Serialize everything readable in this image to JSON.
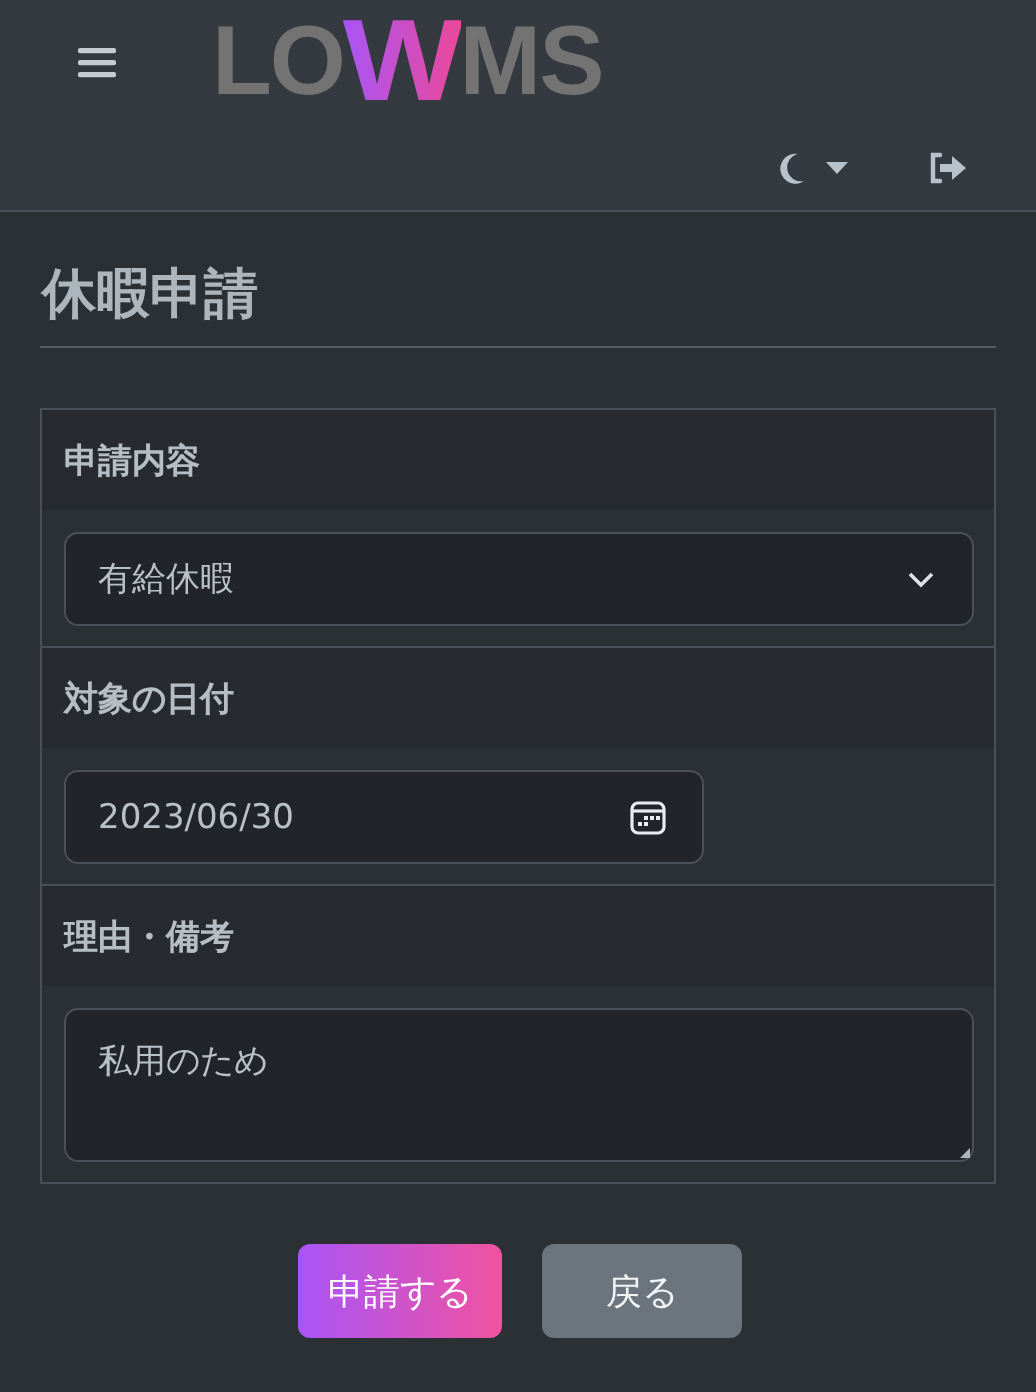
{
  "header": {
    "logo": [
      "LO",
      "W",
      "MS"
    ]
  },
  "title": "休暇申請",
  "sections": [
    {
      "kind": "select",
      "label": "申請内容",
      "value": "有給休暇"
    },
    {
      "kind": "date",
      "label": "対象の日付",
      "value": "2023/06/30"
    },
    {
      "kind": "textarea",
      "label": "理由・備考",
      "value": "私用のため"
    }
  ],
  "buttons": [
    {
      "kind": "primary",
      "label": "申請する"
    },
    {
      "kind": "secondary",
      "label": "戻る"
    }
  ]
}
